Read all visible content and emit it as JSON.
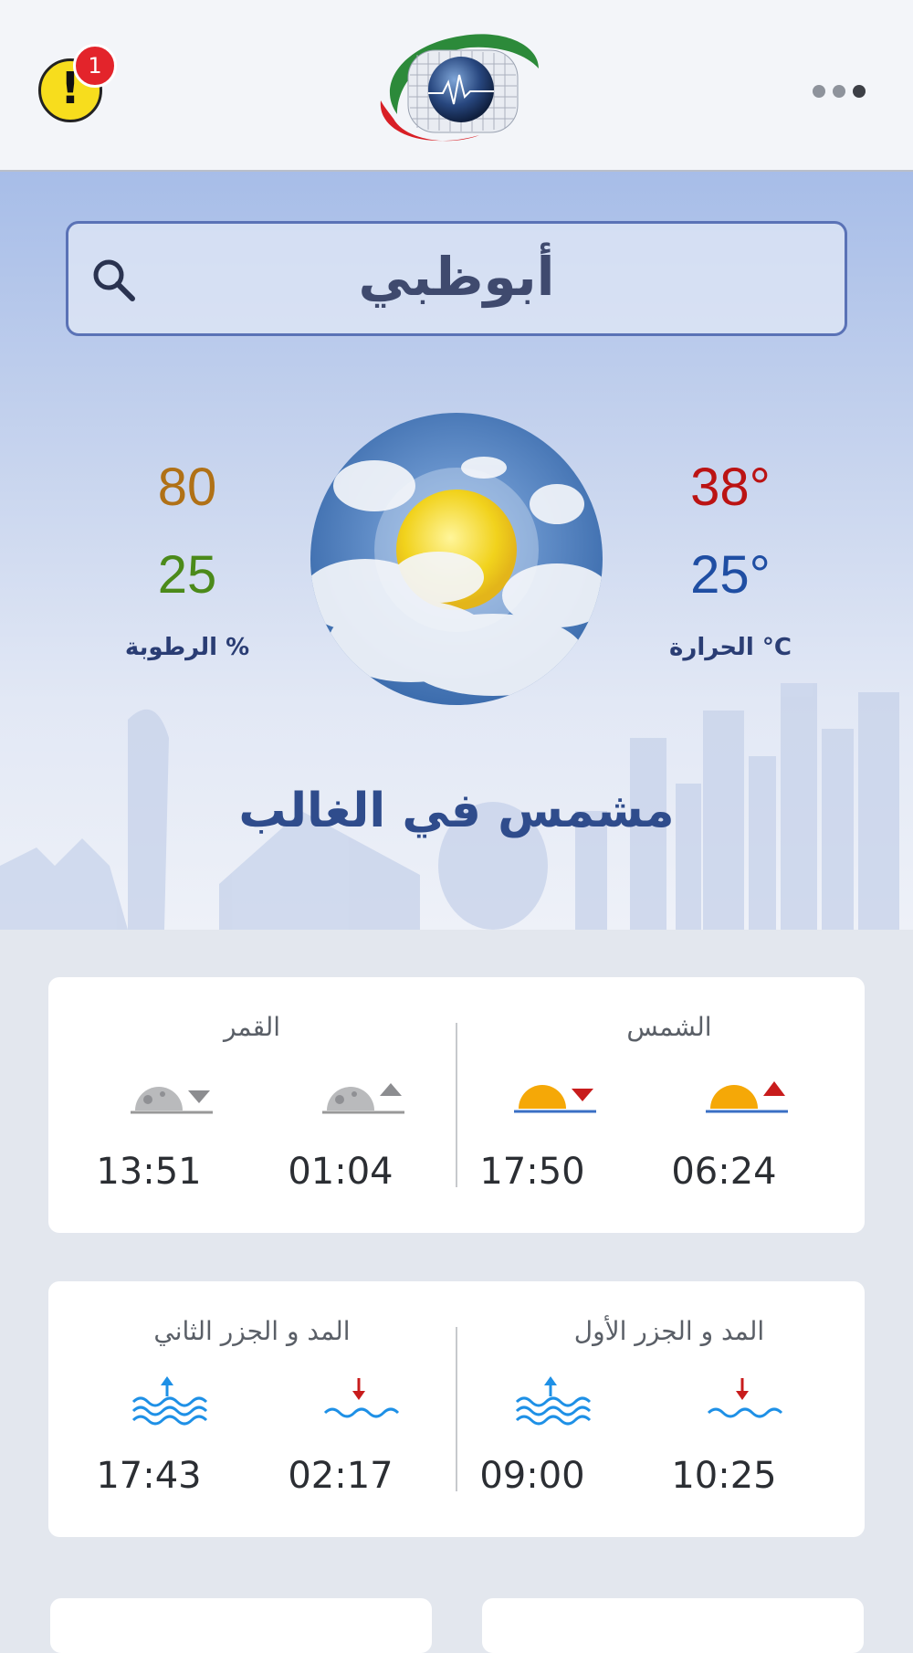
{
  "header": {
    "alert_count": "1",
    "alert_icon": "warning-icon",
    "logo": "ncm-logo",
    "menu_icon": "more-dots-icon"
  },
  "search": {
    "value": "أبوظبي",
    "icon": "search-icon"
  },
  "weather": {
    "humidity_max": "80",
    "humidity_min": "25",
    "humidity_label": "الرطوبة %",
    "temp_max": "38°",
    "temp_min": "25°",
    "temp_label": "الحرارة °C",
    "condition": "مشمس في الغالب",
    "condition_icon": "partly-sunny-icon"
  },
  "sun_moon": {
    "sun_title": "الشمس",
    "moon_title": "القمر",
    "sunrise": "06:24",
    "sunset": "17:50",
    "moonrise": "01:04",
    "moonset": "13:51"
  },
  "tides": {
    "first_title": "المد و الجزر الأول",
    "second_title": "المد و الجزر الثاني",
    "first_low": "10:25",
    "first_high": "09:00",
    "second_low": "02:17",
    "second_high": "17:43"
  },
  "colors": {
    "temp_max": "#bb1313",
    "temp_min": "#1f4ea3",
    "humidity_max": "#b07116",
    "humidity_min": "#4b8a1a",
    "accent": "#2f4c8c"
  }
}
